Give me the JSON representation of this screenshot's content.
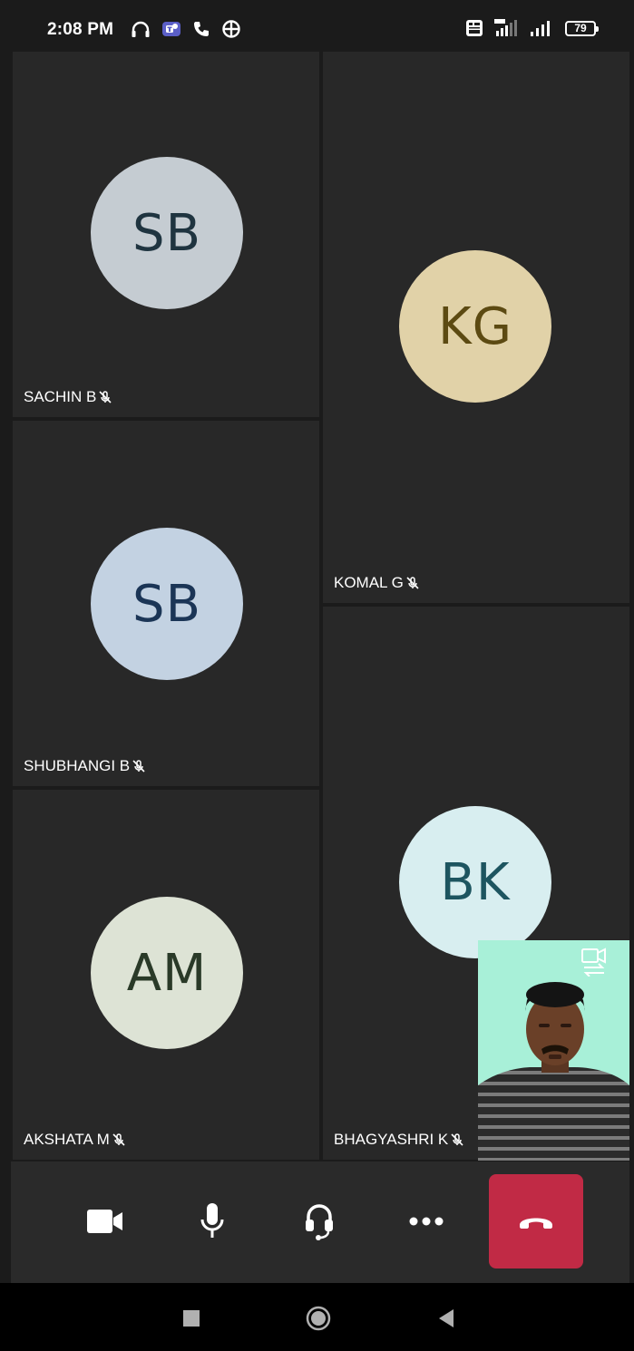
{
  "status_bar": {
    "time": "2:08 PM",
    "left_icons": [
      "headphones-icon",
      "teams-icon",
      "phone-call-icon",
      "vpn-icon"
    ],
    "right_icons": [
      "volte-icon",
      "signal-4g-icon",
      "signal-icon"
    ],
    "battery": "79"
  },
  "participants": [
    {
      "name": "SACHIN B",
      "initials": "SB",
      "avatar_bg": "#c5ccd2",
      "avatar_fg": "#1f3440",
      "muted": true
    },
    {
      "name": "KOMAL G",
      "initials": "KG",
      "avatar_bg": "#e1d2a8",
      "avatar_fg": "#5c4a12",
      "muted": true
    },
    {
      "name": "SHUBHANGI B",
      "initials": "SB",
      "avatar_bg": "#c3d2e2",
      "avatar_fg": "#1b3556",
      "muted": true
    },
    {
      "name": "AKSHATA M",
      "initials": "AM",
      "avatar_bg": "#dde3d5",
      "avatar_fg": "#2a3a28",
      "muted": true
    },
    {
      "name": "BHAGYASHRI K",
      "initials": "BK",
      "avatar_bg": "#d8eef0",
      "avatar_fg": "#1d5560",
      "muted": true
    }
  ],
  "self_view": {
    "background": "#a8f0d8",
    "switch_icon": "switch-camera-icon"
  },
  "controls": {
    "camera_icon": "video-camera-icon",
    "mic_icon": "microphone-icon",
    "audio_icon": "headset-icon",
    "more_icon": "more-options-icon",
    "hangup_icon": "hang-up-icon",
    "hangup_color": "#c12a45"
  },
  "nav_bar": {
    "icons": [
      "recents-icon",
      "home-icon",
      "back-icon"
    ]
  }
}
